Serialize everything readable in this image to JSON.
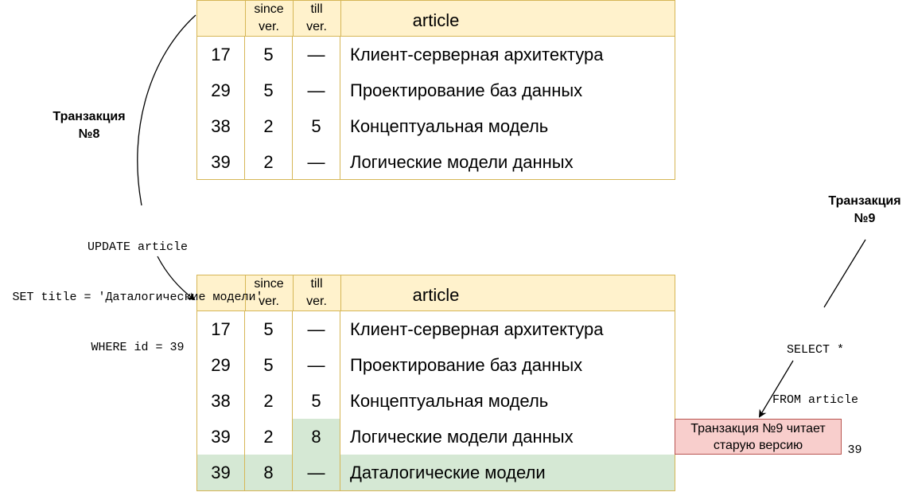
{
  "table_name": "article",
  "headers": {
    "since_line1": "since",
    "since_line2": "ver.",
    "till_line1": "till",
    "till_line2": "ver."
  },
  "before_rows": [
    {
      "id": "17",
      "since": "5",
      "till": "—",
      "title": "Клиент-серверная архитектура"
    },
    {
      "id": "29",
      "since": "5",
      "till": "—",
      "title": "Проектирование баз данных"
    },
    {
      "id": "38",
      "since": "2",
      "till": "5",
      "title": "Концептуальная модель"
    },
    {
      "id": "39",
      "since": "2",
      "till": "—",
      "title": "Логические модели данных"
    }
  ],
  "after_rows": [
    {
      "id": "17",
      "since": "5",
      "till": "—",
      "title": "Клиент-серверная архитектура"
    },
    {
      "id": "29",
      "since": "5",
      "till": "—",
      "title": "Проектирование баз данных"
    },
    {
      "id": "38",
      "since": "2",
      "till": "5",
      "title": "Концептуальная модель"
    },
    {
      "id": "39",
      "since": "2",
      "till": "8",
      "title": "Логические модели данных"
    },
    {
      "id": "39",
      "since": "8",
      "till": "—",
      "title": "Даталогические модели"
    }
  ],
  "transaction8": {
    "line1": "Транзакция",
    "line2": "№8"
  },
  "transaction9": {
    "line1": "Транзакция",
    "line2": "№9"
  },
  "update_sql": {
    "line1": "UPDATE article",
    "line2": "SET title = 'Даталогические модели'",
    "line3": "WHERE id = 39"
  },
  "select_sql": {
    "line1": "SELECT *",
    "line2": "FROM article",
    "line3": "WHERE id = 39"
  },
  "note": {
    "line1": "Транзакция №9 читает",
    "line2": "старую версию"
  },
  "colors": {
    "header_fill": "#fff2cc",
    "border": "#d6b656",
    "highlight": "#d5e8d4",
    "note_fill": "#f8cecc",
    "note_border": "#b85450"
  }
}
